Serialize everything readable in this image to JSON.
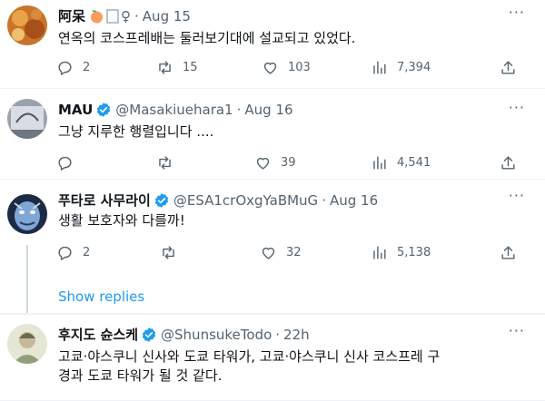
{
  "colors": {
    "link": "#1d9bf0",
    "verified": "#1d9bf0",
    "secondary": "#536471"
  },
  "tweets": [
    {
      "name": "阿呆",
      "badges": [
        "peach-emoji",
        "box-emoji",
        "female-sign-emoji"
      ],
      "female_sign": "♀",
      "handle": "",
      "dot": "·",
      "time": "Aug 15",
      "text": "연옥의 코스프레배는 둘러보기대에 설교되고 있었다.",
      "replies": "2",
      "retweets": "15",
      "likes": "103",
      "views": "7,394"
    },
    {
      "name": "MAU",
      "verified": true,
      "handle": "@Masakiuehara1",
      "dot": "·",
      "time": "Aug 16",
      "text": "그냥 지루한 행렬입니다 ....",
      "replies": "",
      "retweets": "",
      "likes": "39",
      "views": "4,541"
    },
    {
      "name": "푸타로 사무라이",
      "verified": true,
      "handle": "@ESA1crOxgYaBMuG",
      "dot": "·",
      "time": "Aug 16",
      "text": "생활 보호자와 다를까!",
      "replies": "2",
      "retweets": "",
      "likes": "32",
      "views": "5,138"
    },
    {
      "name": "후지도 슌스케",
      "verified": true,
      "handle": "@ShunsukeTodo",
      "dot": "·",
      "time": "22h",
      "text": "고쿄·야스쿠니 신사와 도쿄 타워가, 고쿄·야스쿠니 신사 코스프레 구\n경과 도쿄 타워가 될 것 같다."
    }
  ],
  "show_replies": "Show replies",
  "more_glyph": "···"
}
